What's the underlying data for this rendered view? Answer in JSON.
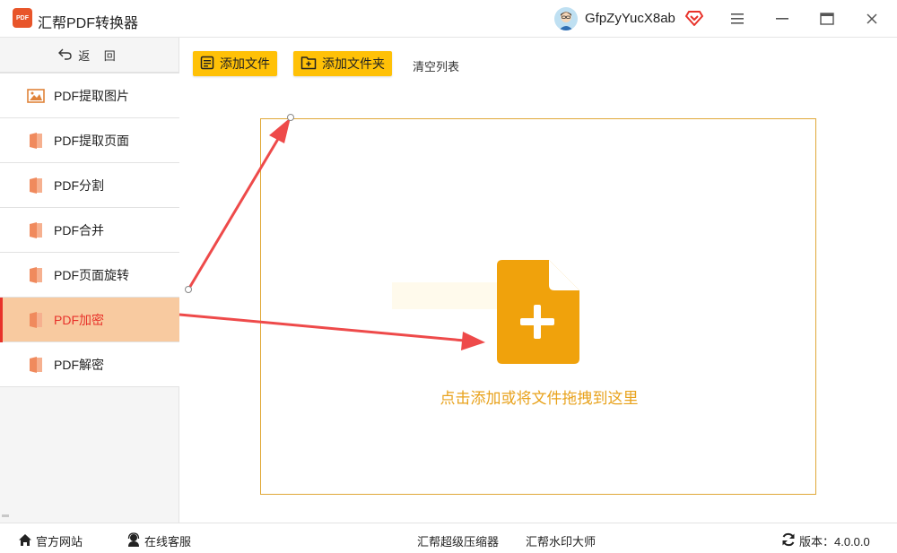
{
  "app": {
    "title": "汇帮PDF转换器",
    "logo_text": "PDF",
    "username": "GfpZyYucX8ab",
    "accent_color": "#ffc107",
    "active_color": "#e8322a"
  },
  "sidebar": {
    "back_label": "返 回",
    "items": [
      {
        "label": "PDF提取图片",
        "icon": "image-icon"
      },
      {
        "label": "PDF提取页面",
        "icon": "pdf-file-icon"
      },
      {
        "label": "PDF分割",
        "icon": "pdf-file-icon"
      },
      {
        "label": "PDF合并",
        "icon": "pdf-file-icon"
      },
      {
        "label": "PDF页面旋转",
        "icon": "pdf-file-icon"
      },
      {
        "label": "PDF加密",
        "icon": "pdf-file-icon",
        "active": true
      },
      {
        "label": "PDF解密",
        "icon": "pdf-file-icon"
      }
    ]
  },
  "toolbar": {
    "add_file": "添加文件",
    "add_folder": "添加文件夹",
    "clear_list": "清空列表"
  },
  "dropzone": {
    "hint": "点击添加或将文件拖拽到这里"
  },
  "statusbar": {
    "website": "官方网站",
    "support": "在线客服",
    "compressor": "汇帮超级压缩器",
    "watermark": "汇帮水印大师",
    "version": "版本：4.0.0.0"
  }
}
